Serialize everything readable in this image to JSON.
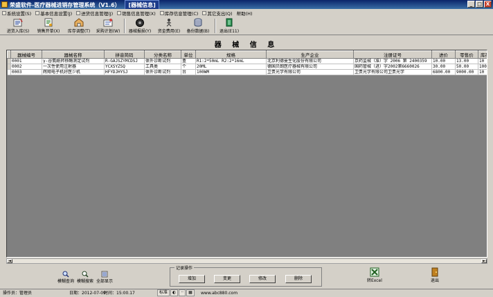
{
  "window": {
    "title": "荣盛软件-医疗器械进销存管理系统（V1.6）",
    "subtitle": "[器械信息]",
    "minimize": "_",
    "maximize": "□",
    "close": "X"
  },
  "menu": [
    {
      "label": "系统设置(S)"
    },
    {
      "label": "基本信息设置(J)"
    },
    {
      "label": "进货信息管理(J)"
    },
    {
      "label": "销售信息管理(X)"
    },
    {
      "label": "库存信息管理(C)"
    },
    {
      "label": "其它支出(Q)"
    },
    {
      "label": "帮助(H)"
    }
  ],
  "toolbar": [
    {
      "label": "进货入库(S)",
      "icon": "stock-in-icon"
    },
    {
      "label": "销售开单(X)",
      "icon": "sales-order-icon"
    },
    {
      "label": "库存调整(T)",
      "icon": "inventory-adjust-icon"
    },
    {
      "label": "采购计划(W)",
      "icon": "purchase-plan-icon"
    },
    {
      "label": "器械报损(Y)",
      "icon": "loss-report-icon"
    },
    {
      "label": "资金费用(E)",
      "icon": "expense-icon"
    },
    {
      "label": "备份数据(B)",
      "icon": "backup-icon"
    },
    {
      "label": "退出(E11)",
      "icon": "exit-icon"
    }
  ],
  "page_title": "器 械 信 息",
  "table": {
    "columns": [
      "器械编号",
      "器械名称",
      "拼音简码",
      "分类名称",
      "单位",
      "规格",
      "生产企业",
      "注册证号",
      "进价",
      "零售价",
      "库存"
    ],
    "rows": [
      [
        "0001",
        "γ-谷氨酰转移酶测定试剂",
        "R-GAJSZYMCDSJ",
        "体外诊断试剂",
        "盒",
        "R1:2*50mL R2:2*16mL",
        "北京利德曼生化股份有限公司",
        "京药监械（准）字 2006 第 2400359",
        "10.00",
        "13.00",
        "10"
      ],
      [
        "0002",
        "一次性使用注射器",
        "YCXSYZSQ",
        "工具类",
        "个",
        "20ML",
        "德国贝朗医疗器械有限公司",
        "国药管械（进）字2002第6660026",
        "30.00",
        "50.00",
        "1000"
      ],
      [
        "0003",
        "辉翔电子机好医少机",
        "HFYDJHYSJ",
        "体外诊断试剂",
        "台",
        "100WM",
        "卫贵光学有限公司",
        "卫贵光学有限公司卫贵光学",
        "6800.00",
        "9000.00",
        "10"
      ]
    ]
  },
  "bottom_buttons": [
    {
      "label": "模糊查询",
      "icon": "search-icon"
    },
    {
      "label": "模糊搜索",
      "icon": "magnifier-icon"
    },
    {
      "label": "全部显示",
      "icon": "show-all-icon"
    }
  ],
  "record_ops": {
    "legend": "记录操作",
    "buttons": [
      "增加",
      "变更",
      "修改",
      "删除"
    ]
  },
  "export_label": "转Excel",
  "close_label": "退出",
  "status": {
    "operator": "操作员：管理员",
    "date": "日期：2012-07-09",
    "time": "时间：15:00.17",
    "site": "www.abc880.com",
    "ime": "标准"
  }
}
